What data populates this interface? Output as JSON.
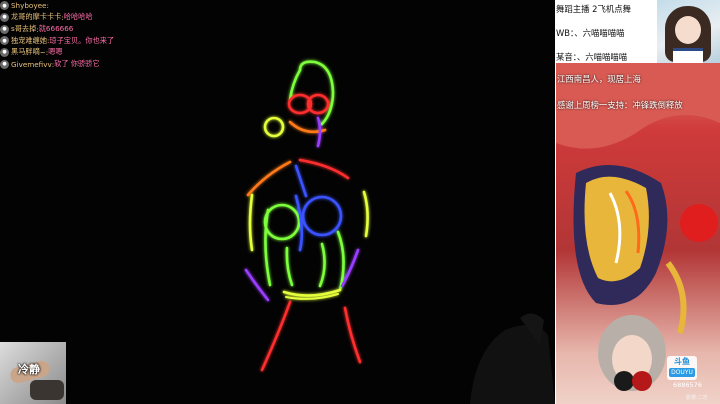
{
  "chat": {
    "messages": [
      {
        "user": "Shyboyee",
        "sep": ":",
        "text": "",
        "avatar": "shy-avatar",
        "color": "#e8c27a"
      },
      {
        "user": "龙哥的摩卡卡卡",
        "sep": ":",
        "text": "哈哈哈哈",
        "avatar": "dragon-avatar",
        "color": "#ff6ea8"
      },
      {
        "user": "s哥去掉",
        "sep": ":",
        "text": "就666666",
        "avatar": "s-avatar",
        "color": "#ff6ea8"
      },
      {
        "user": "独宠难缠她",
        "sep": ":",
        "text": "琼子宝贝。你也来了",
        "avatar": "lonely-avatar",
        "color": "#ff6ea8"
      },
      {
        "user": "黑马胖嘀",
        "sep": "~:",
        "text": "嗯嗯",
        "avatar": "horse-avatar",
        "color": "#ff6ea8"
      },
      {
        "user": "Givemefivv",
        "sep": ":",
        "text": "软了 你骄骄它",
        "avatar": "give-avatar",
        "color": "#ff6ea8"
      }
    ]
  },
  "streamer_info": {
    "line1": "舞蹈主播   2飞机点舞",
    "line2": "WB：、六喵喵喵喵",
    "line3": "某音：、六喵喵喵喵",
    "line4": "江西南昌人，现居上海",
    "line5": "感谢上周榜一支持：冲锋跌倒释放"
  },
  "camera": {
    "label": "冷静"
  },
  "badge": {
    "title": "斗鱼",
    "tag": "DOUYU",
    "room_id": "6886576",
    "watermark": "影楼:二次"
  },
  "colors": {
    "glow_red": "#ff2d2d",
    "glow_green": "#7dff3a",
    "glow_blue": "#3a53ff",
    "glow_orange": "#ff7a18",
    "glow_yellow": "#e5ff3a",
    "glow_purple": "#9a3cff"
  }
}
